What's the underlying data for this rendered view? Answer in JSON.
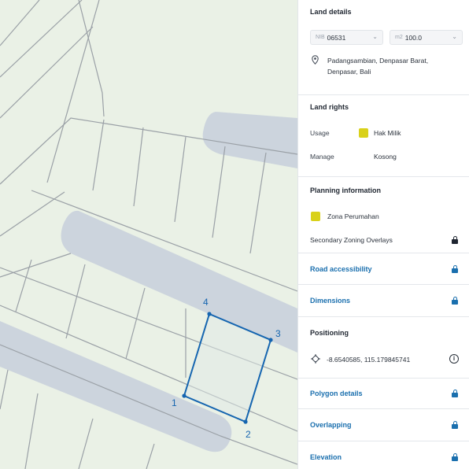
{
  "map": {
    "vertex_labels": [
      "1",
      "2",
      "3",
      "4"
    ]
  },
  "land_details": {
    "title": "Land details",
    "nib_prefix": "NIB",
    "nib_value": "06531",
    "area_prefix": "m2",
    "area_value": "100.0",
    "address_line1": "Padangsambian, Denpasar Barat,",
    "address_line2": "Denpasar, Bali"
  },
  "land_rights": {
    "title": "Land rights",
    "usage_label": "Usage",
    "usage_value": "Hak Milik",
    "usage_color": "#d9d11a",
    "manage_label": "Manage",
    "manage_value": "Kosong"
  },
  "planning": {
    "title": "Planning information",
    "zone_label": "Zona Perumahan",
    "zone_color": "#d9d11a",
    "overlay_label": "Secondary Zoning Overlays"
  },
  "links": {
    "road_accessibility": "Road accessibility",
    "dimensions": "Dimensions",
    "polygon_details": "Polygon details",
    "overlapping": "Overlapping",
    "elevation": "Elevation"
  },
  "positioning": {
    "title": "Positioning",
    "coordinates": "-8.6540585, 115.179845741"
  },
  "colors": {
    "accent": "#1a6fae",
    "map_background": "#eaf1e6",
    "road_band": "#c7cfdb",
    "parcel_line": "#9aa0a6",
    "selected_parcel": "#1565b0"
  }
}
